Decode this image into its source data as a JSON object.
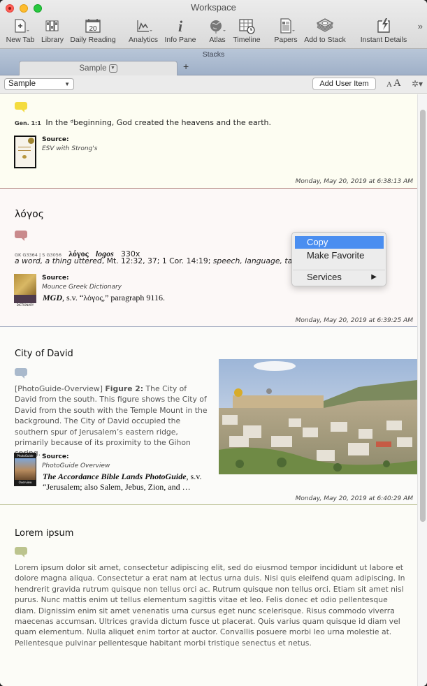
{
  "window": {
    "title": "Workspace"
  },
  "toolbar": {
    "items": [
      {
        "label": "New Tab",
        "icon": "new-tab-icon"
      },
      {
        "label": "Library",
        "icon": "library-icon"
      },
      {
        "label": "Daily Reading",
        "icon": "calendar-icon",
        "icon_text": "20"
      },
      {
        "label": "Analytics",
        "icon": "analytics-icon"
      },
      {
        "label": "Info Pane",
        "icon": "info-icon"
      },
      {
        "label": "Atlas",
        "icon": "globe-icon"
      },
      {
        "label": "Timeline",
        "icon": "timeline-icon"
      },
      {
        "label": "Papers",
        "icon": "papers-icon"
      },
      {
        "label": "Add to Stack",
        "icon": "stack-icon"
      },
      {
        "label": "Instant Details",
        "icon": "instant-details-icon"
      }
    ],
    "overflow": "»"
  },
  "stacks": {
    "title": "Stacks",
    "tabs": [
      {
        "label": "Sample",
        "active": true
      }
    ],
    "add": "+"
  },
  "controls": {
    "selected_stack": "Sample",
    "add_user_item": "Add User Item",
    "font_smaller": "A",
    "font_larger": "A",
    "gear": "✲▾"
  },
  "entries": [
    {
      "title": "",
      "bubble_color": "#f4dc3f",
      "border_color": "#b58a85",
      "reference": "Gen. 1:1",
      "text": "In the ᵈbeginning, God created the heavens and the earth.",
      "source_label": "Source:",
      "source_name": "ESV with Strong's",
      "timestamp": "Monday, May 20, 2019 at 6:38:13 AM"
    },
    {
      "title": "λόγος",
      "bubble_color": "#c98a8c",
      "border_color": "#a9b2c5",
      "codes": "GK G3364 | S G3056",
      "lemma": "λόγος",
      "translit": "logos",
      "count": "330x",
      "definition_italic": "a word, a thing uttered",
      "definition_refs": ", Mt. 12:32, 37; 1 Cor. 14:19; ",
      "definition_tail": "speech, language, talk,",
      "source_label": "Source:",
      "source_name": "Mounce Greek Dictionary",
      "citation_italic": "MGD",
      "citation_rest": ", s.v. “λόγος,” paragraph 9116.",
      "timestamp": "Monday, May 20, 2019 at 6:39:25 AM"
    },
    {
      "title": "City of David",
      "bubble_color": "#a9b9cc",
      "border_color": "#b8bd8f",
      "text_prefix": "[PhotoGuide-Overview] ",
      "text_bold": "Figure 2:",
      "text_rest": " The City of David from the south. This figure shows the City of David from the south with the Temple Mount in the background. The City of David occupied the southern spur of Jerusalem’s eastern ridge, primarily because of its proximity to the Gihon spring.",
      "source_label": "Source:",
      "source_name": "PhotoGuide Overview",
      "citation_italic": "The Accordance Bible Lands PhotoGuide",
      "citation_rest": ", s.v. “Jerusalem; also Salem, Jebus, Zion, and …",
      "image_alt": "Photo of the City of David from the south with the Temple Mount",
      "timestamp": "Monday, May 20, 2019 at 6:40:29 AM"
    },
    {
      "title": "Lorem ipsum",
      "bubble_color": "#bcc48e",
      "text": "Lorem ipsum dolor sit amet, consectetur adipiscing elit, sed do eiusmod tempor incididunt ut labore et dolore magna aliqua. Consectetur a erat nam at lectus urna duis. Nisi quis eleifend quam adipiscing. In hendrerit gravida rutrum quisque non tellus orci ac. Rutrum quisque non tellus orci. Etiam sit amet nisl purus. Nunc mattis enim ut tellus elementum sagittis vitae et leo. Felis donec et odio pellentesque diam. Dignissim enim sit amet venenatis urna cursus eget nunc scelerisque. Risus commodo viverra maecenas accumsan. Ultrices gravida dictum fusce ut placerat. Quis varius quam quisque id diam vel quam elementum. Nulla aliquet enim tortor at auctor. Convallis posuere morbi leo urna molestie at. Pellentesque pulvinar pellentesque habitant morbi tristique senectus et netus."
    }
  ],
  "context_menu": {
    "items": [
      {
        "label": "Copy",
        "highlighted": true
      },
      {
        "label": "Make Favorite",
        "highlighted": false
      },
      {
        "label": "Services",
        "highlighted": false,
        "submenu": true
      }
    ],
    "submenu_arrow": "▶",
    "highlight_color": "#4a8ef0"
  }
}
